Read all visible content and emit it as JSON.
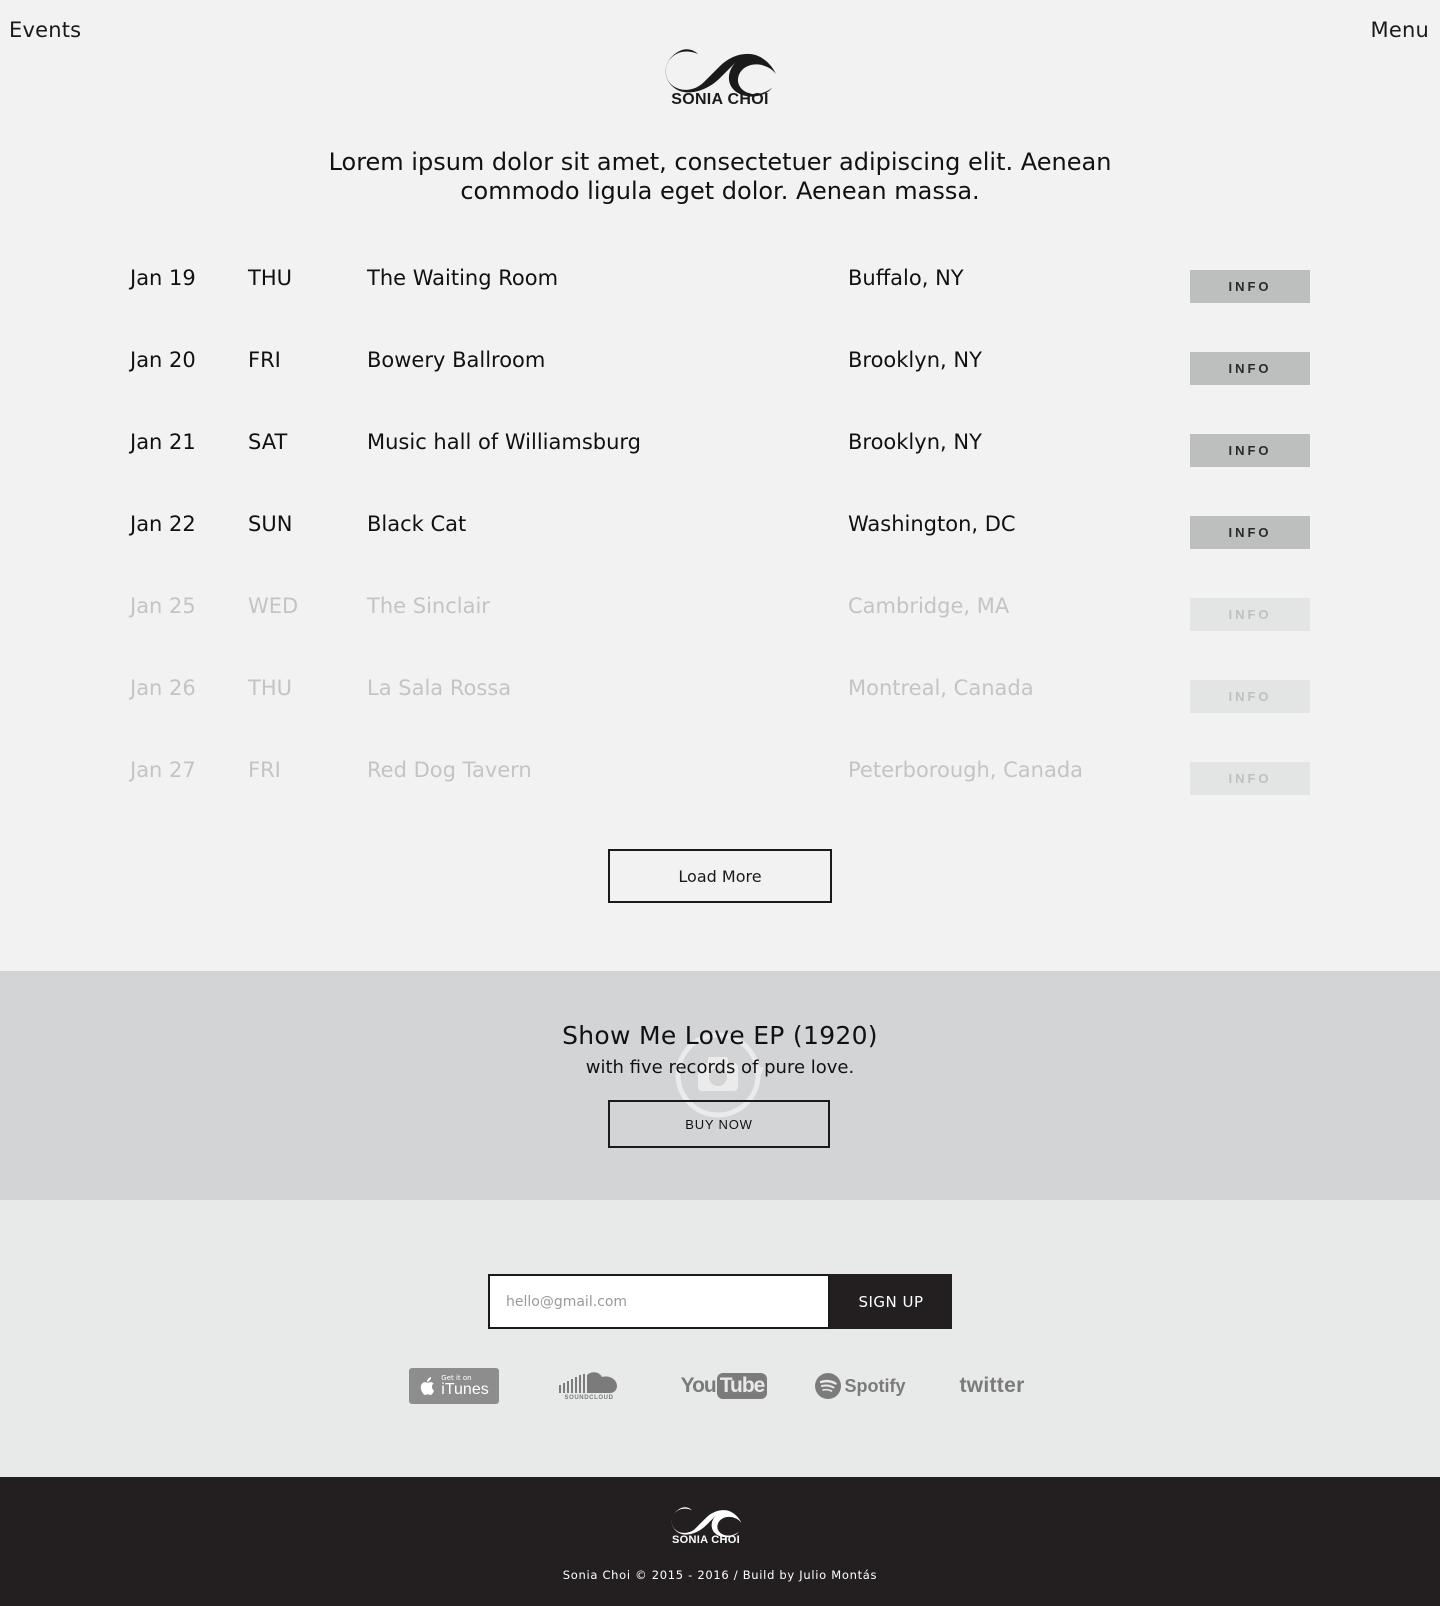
{
  "header": {
    "left_link": "Events",
    "right_link": "Menu",
    "logo_text": "SONIA CHOI"
  },
  "intro": {
    "text": "Lorem ipsum dolor sit amet, consectetuer adipiscing elit. Aenean commodo ligula eget dolor. Aenean massa."
  },
  "events": [
    {
      "date": "Jan 19",
      "day": "THU",
      "venue": "The Waiting Room",
      "city": "Buffalo, NY",
      "button": "INFO",
      "faded": false
    },
    {
      "date": "Jan 20",
      "day": "FRI",
      "venue": "Bowery Ballroom",
      "city": "Brooklyn, NY",
      "button": "INFO",
      "faded": false
    },
    {
      "date": "Jan 21",
      "day": "SAT",
      "venue": "Music hall of Williamsburg",
      "city": "Brooklyn, NY",
      "button": "INFO",
      "faded": false
    },
    {
      "date": "Jan 22",
      "day": "SUN",
      "venue": "Black Cat",
      "city": "Washington, DC",
      "button": "INFO",
      "faded": false
    },
    {
      "date": "Jan 25",
      "day": "WED",
      "venue": "The Sinclair",
      "city": "Cambridge, MA",
      "button": "INFO",
      "faded": true
    },
    {
      "date": "Jan 26",
      "day": "THU",
      "venue": "La Sala Rossa",
      "city": "Montreal, Canada",
      "button": "INFO",
      "faded": true
    },
    {
      "date": "Jan 27",
      "day": "FRI",
      "venue": "Red Dog Tavern",
      "city": "Peterborough, Canada",
      "button": "INFO",
      "faded": true
    }
  ],
  "load_more": "Load More",
  "promo": {
    "title": "Show Me Love EP (1920)",
    "subtitle": "with five records of pure love.",
    "button": "BUY NOW",
    "icon": "camera-rotate-icon"
  },
  "signup": {
    "placeholder": "hello@gmail.com",
    "value": "",
    "button": "SIGN UP"
  },
  "platforms": {
    "itunes_small": "Get it on",
    "itunes_big": "iTunes",
    "soundcloud": "SOUNDCLOUD",
    "youtube_you": "You",
    "youtube_tube": "Tube",
    "spotify": "Spotify",
    "twitter": "twitter"
  },
  "footer": {
    "logo_text": "SONIA CHOI",
    "copyright": "Sonia Choi © 2015 - 2016 / Build by Julio Montás"
  },
  "colors": {
    "page_bg": "#f1f2f1",
    "promo_bg": "#d3d4d6",
    "signup_bg": "#e8e9e9",
    "footer_bg": "#231f20",
    "info_button": "#bdbebe",
    "faded_text": "#c3c5c5"
  }
}
